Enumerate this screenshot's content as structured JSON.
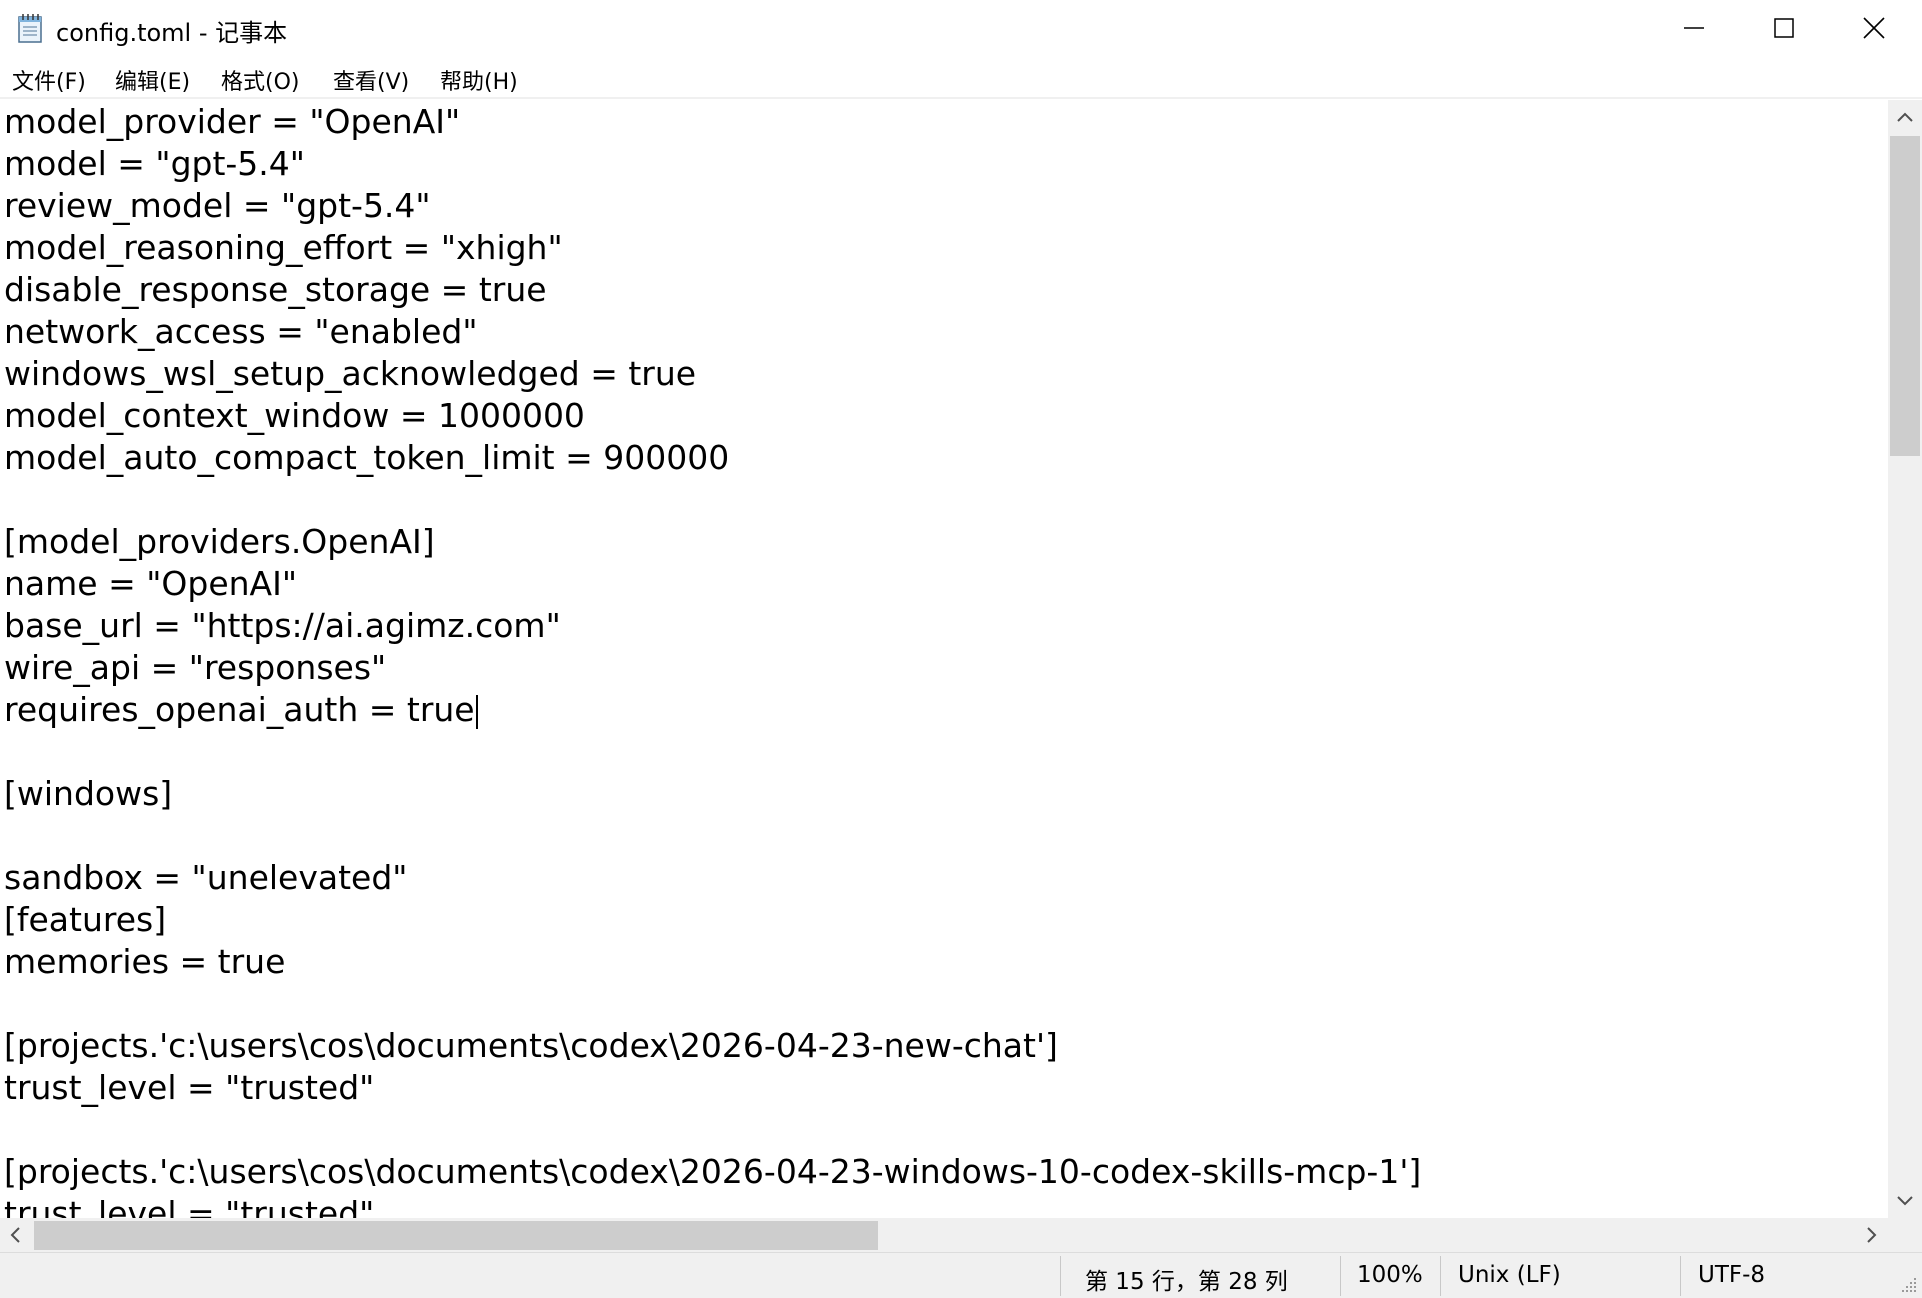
{
  "window": {
    "title": "config.toml - 记事本"
  },
  "menu": [
    "文件(F)",
    "编辑(E)",
    "格式(O)",
    "查看(V)",
    "帮助(H)"
  ],
  "editor": {
    "lines": [
      "model_provider = \"OpenAI\"",
      "model = \"gpt-5.4\"",
      "review_model = \"gpt-5.4\"",
      "model_reasoning_effort = \"xhigh\"",
      "disable_response_storage = true",
      "network_access = \"enabled\"",
      "windows_wsl_setup_acknowledged = true",
      "model_context_window = 1000000",
      "model_auto_compact_token_limit = 900000",
      "",
      "[model_providers.OpenAI]",
      "name = \"OpenAI\"",
      "base_url = \"https://ai.agimz.com\"",
      "wire_api = \"responses\"",
      "requires_openai_auth = true",
      "",
      "[windows]",
      "",
      "sandbox = \"unelevated\"",
      "[features]",
      "memories = true",
      "",
      "[projects.'c:\\users\\cos\\documents\\codex\\2026-04-23-new-chat']",
      "trust_level = \"trusted\"",
      "",
      "[projects.'c:\\users\\cos\\documents\\codex\\2026-04-23-windows-10-codex-skills-mcp-1']",
      "trust_level = \"trusted\""
    ]
  },
  "status": {
    "position": "第 15 行，第 28 列",
    "zoom": "100%",
    "line_ending": "Unix (LF)",
    "encoding": "UTF-8"
  }
}
